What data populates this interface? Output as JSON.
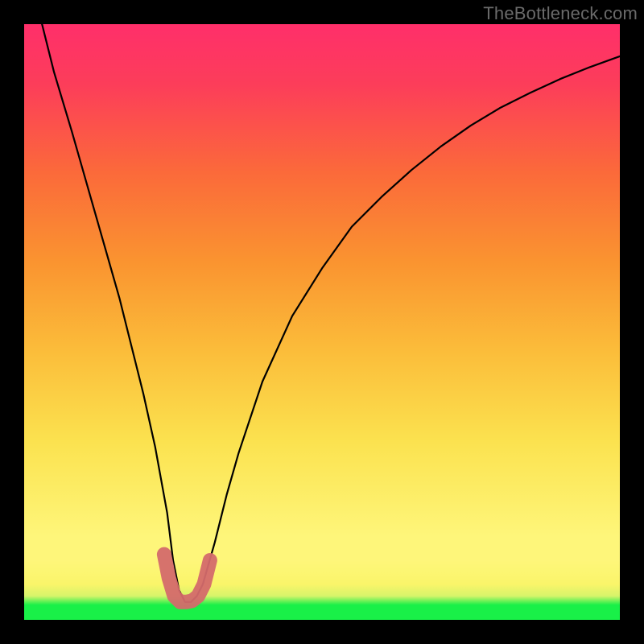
{
  "watermark": "TheBottleneck.com",
  "chart_data": {
    "type": "line",
    "title": "",
    "xlabel": "",
    "ylabel": "",
    "xlim": [
      0,
      100
    ],
    "ylim": [
      0,
      100
    ],
    "series": [
      {
        "name": "bottleneck-curve",
        "x": [
          3,
          5,
          8,
          10,
          12,
          14,
          16,
          18,
          20,
          22,
          24,
          25,
          26,
          27,
          28,
          29,
          30,
          32,
          34,
          36,
          40,
          45,
          50,
          55,
          60,
          65,
          70,
          75,
          80,
          85,
          90,
          95,
          100
        ],
        "values": [
          100,
          92,
          82,
          75,
          68,
          61,
          54,
          46,
          38,
          29,
          18,
          10,
          5,
          3,
          3,
          4,
          6,
          13,
          21,
          28,
          40,
          51,
          59,
          66,
          71,
          75.5,
          79.5,
          83,
          86,
          88.5,
          90.8,
          92.8,
          94.6
        ]
      },
      {
        "name": "highlight-bottom",
        "x": [
          23.5,
          24.3,
          25.2,
          26.2,
          27.2,
          28.2,
          29.2,
          30.2,
          31.2
        ],
        "values": [
          11,
          7,
          4,
          3,
          3,
          3.2,
          4,
          6,
          10
        ]
      }
    ],
    "background_gradient": {
      "stops": [
        {
          "pos": 0.0,
          "color": "#19f048"
        },
        {
          "pos": 0.05,
          "color": "#d6f46a"
        },
        {
          "pos": 0.14,
          "color": "#fef67a"
        },
        {
          "pos": 0.45,
          "color": "#fbbd3a"
        },
        {
          "pos": 0.75,
          "color": "#fb6a3a"
        },
        {
          "pos": 1.0,
          "color": "#ff2f6a"
        }
      ]
    }
  }
}
